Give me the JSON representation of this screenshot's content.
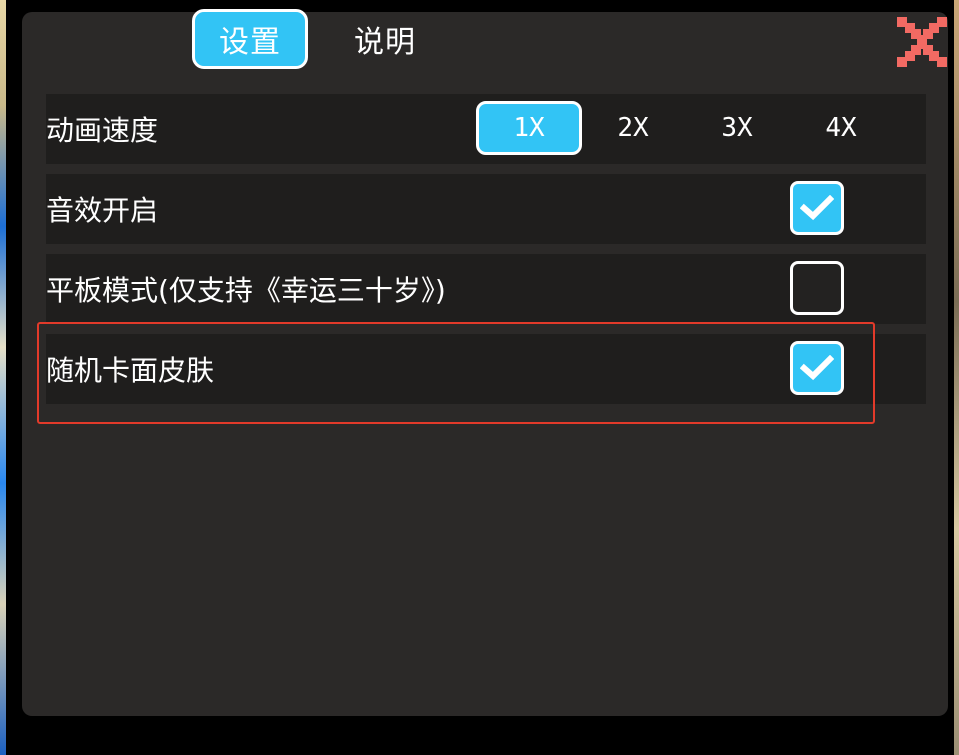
{
  "tabs": [
    {
      "label": "设置",
      "active": true
    },
    {
      "label": "说明",
      "active": false
    }
  ],
  "close_icon": "close-x-icon",
  "colors": {
    "accent": "#32c4f5",
    "panel": "#2b2928",
    "row": "#1f1e1d",
    "close": "#f26a63",
    "highlight": "#e23a2a"
  },
  "settings": {
    "animation_speed": {
      "label": "动画速度",
      "options": [
        "1X",
        "2X",
        "3X",
        "4X"
      ],
      "selected": "1X"
    },
    "sound": {
      "label": "音效开启",
      "checked": true
    },
    "tablet_mode": {
      "label": "平板模式(仅支持《幸运三十岁》)",
      "checked": false
    },
    "random_skin": {
      "label": "随机卡面皮肤",
      "checked": true
    }
  }
}
